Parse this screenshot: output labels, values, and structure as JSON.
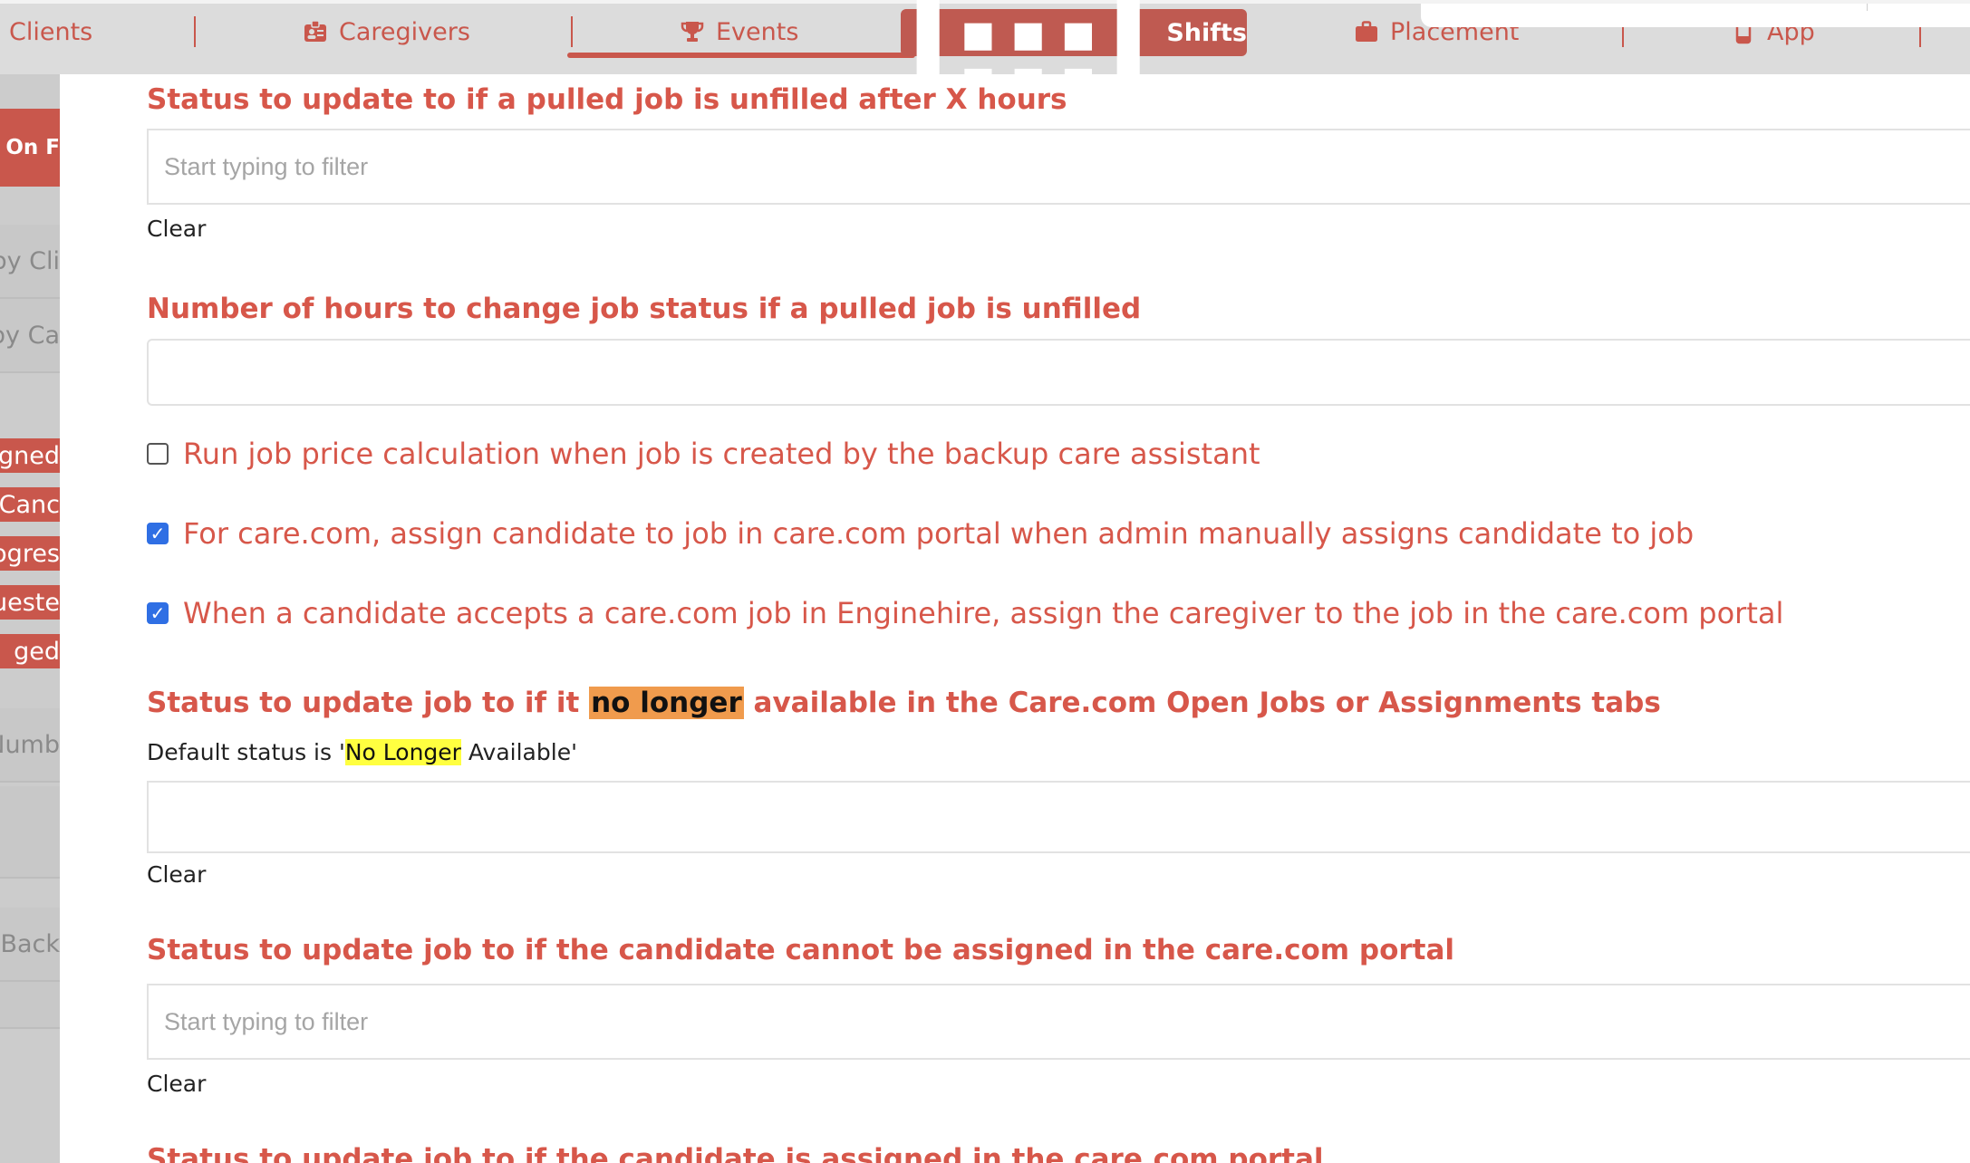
{
  "nav": {
    "items": [
      {
        "label": "Clients",
        "icon": "none"
      },
      {
        "label": "Caregivers",
        "icon": "id-badge-icon"
      },
      {
        "label": "Events",
        "icon": "trophy-icon"
      },
      {
        "label": "Shifts",
        "icon": "calendar-icon"
      },
      {
        "label": "Placement",
        "icon": "briefcase-icon"
      },
      {
        "label": "App",
        "icon": "mobile-icon"
      }
    ],
    "active": "Shifts",
    "accent_color": "#bf5a51"
  },
  "sidebar": {
    "items": [
      {
        "label": "w On F"
      },
      {
        "label": "by Cli"
      },
      {
        "label": "by Ca"
      },
      {
        "label": "gned"
      },
      {
        "label": "Canc"
      },
      {
        "label": "ogres"
      },
      {
        "label": "ueste"
      },
      {
        "label": "ged"
      },
      {
        "label": "Numb"
      },
      {
        "label": "Back"
      }
    ]
  },
  "form": {
    "unfilled_status": {
      "heading": "Status to update to if a pulled job is unfilled after X hours",
      "placeholder": "Start typing to filter",
      "clear": "Clear"
    },
    "hours": {
      "heading": "Number of hours to change job status if a pulled job is unfilled",
      "value": ""
    },
    "checkboxes": [
      {
        "label": "Run job price calculation when job is created by the backup care assistant",
        "checked": false
      },
      {
        "label": "For care.com, assign candidate to job in care.com portal when admin manually assigns candidate to job",
        "checked": true
      },
      {
        "label": "When a candidate accepts a care.com job in Enginehire, assign the caregiver to the job in the care.com portal",
        "checked": true
      }
    ],
    "no_longer": {
      "heading_before": "Status to update job to if it ",
      "heading_highlight": "no longer",
      "heading_after": " available in the Care.com Open Jobs or Assignments tabs",
      "note_before": "Default status is '",
      "note_highlight": "No Longer",
      "note_after": " Available'",
      "value": "",
      "clear": "Clear"
    },
    "cannot_assign": {
      "heading": "Status to update job to if the candidate cannot be assigned in the care.com portal",
      "placeholder": "Start typing to filter",
      "clear": "Clear"
    },
    "assigned": {
      "heading": "Status to update job to if the candidate is assigned in the care.com portal"
    }
  },
  "colors": {
    "heading": "#d7574a",
    "checkbox_checked": "#2f6fe4",
    "highlight_orange": "#f09b4d",
    "highlight_yellow": "#ffff40"
  }
}
